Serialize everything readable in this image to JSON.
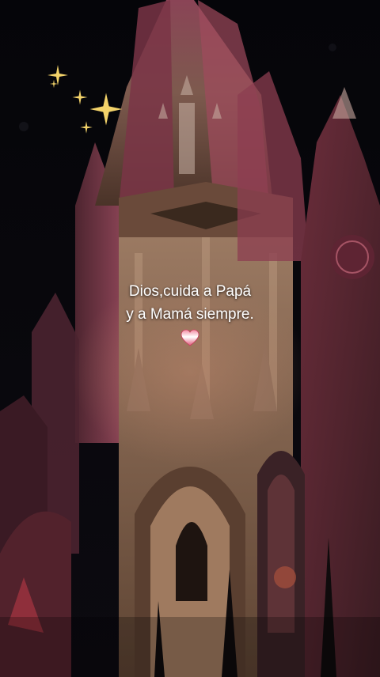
{
  "caption": {
    "line1": "Dios,cuida a Papá",
    "line2": "y a Mamá siempre."
  },
  "decorations": {
    "heart_emoji": "heart-icon",
    "sparkles": "sparkle-icon"
  },
  "colors": {
    "background": "#06060a",
    "stone_warm": "#9a7a62",
    "stone_pink": "#a34a5c",
    "sparkle": "#f3d36a",
    "caption_text": "#ffffff"
  }
}
